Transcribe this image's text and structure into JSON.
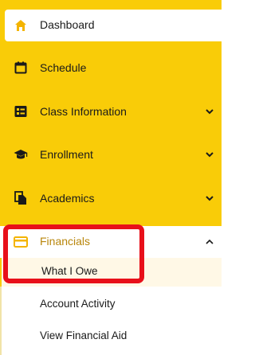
{
  "colors": {
    "accent_yellow": "#f9cc08",
    "highlight_red": "#e8101a",
    "active_text": "#b8860b"
  },
  "nav": {
    "dashboard": {
      "label": "Dashboard",
      "icon": "home-icon"
    },
    "items": [
      {
        "label": "Schedule",
        "icon": "calendar-icon",
        "expandable": false
      },
      {
        "label": "Class Information",
        "icon": "list-card-icon",
        "expandable": true
      },
      {
        "label": "Enrollment",
        "icon": "graduation-cap-icon",
        "expandable": true
      },
      {
        "label": "Academics",
        "icon": "documents-icon",
        "expandable": true
      }
    ],
    "financials": {
      "label": "Financials",
      "icon": "credit-card-icon",
      "expanded": true,
      "subitems": [
        {
          "label": "What I Owe",
          "active": true
        },
        {
          "label": "Account Activity",
          "active": false
        },
        {
          "label": "View Financial Aid",
          "active": false
        }
      ]
    }
  }
}
